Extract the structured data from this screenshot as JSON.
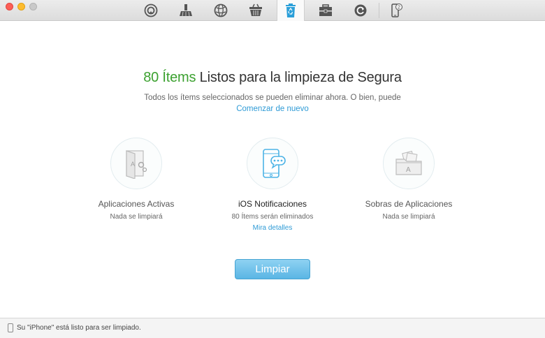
{
  "toolbar": {
    "tools": [
      {
        "id": "airbackup",
        "icon": "airplay-backup-icon"
      },
      {
        "id": "clean",
        "icon": "broom-icon"
      },
      {
        "id": "internet",
        "icon": "globe-icon"
      },
      {
        "id": "junk",
        "icon": "basket-icon"
      },
      {
        "id": "privacy",
        "icon": "recycle-bin-icon"
      },
      {
        "id": "toolbox",
        "icon": "toolbox-icon"
      },
      {
        "id": "backup",
        "icon": "refresh-icon"
      },
      {
        "id": "device",
        "icon": "phone-badge-icon",
        "badge": "2"
      }
    ],
    "active": "privacy"
  },
  "main": {
    "headline_count": "80 Ítems",
    "headline_rest": " Listos para la limpieza de Segura",
    "subline": "Todos los ítems seleccionados se pueden eliminar ahora. O bien, puede",
    "restart_link": "Comenzar de nuevo"
  },
  "cards": [
    {
      "title": "Aplicaciones Activas",
      "note": "Nada se limpiará",
      "icon": "app-door-icon"
    },
    {
      "title": "iOS Notificaciones",
      "note": "80 Ítems serán eliminados",
      "link": "Mira detalles",
      "icon": "phone-chat-icon"
    },
    {
      "title": "Sobras de Aplicaciones",
      "note": "Nada se limpiará",
      "icon": "folder-apps-icon"
    }
  ],
  "clean_button": "Limpiar",
  "status": "Su \"iPhone\" está listo para ser limpiado.",
  "colors": {
    "accent_green": "#3ca130",
    "link_blue": "#2f9bd6",
    "button_blue": "#5ab5e4"
  }
}
